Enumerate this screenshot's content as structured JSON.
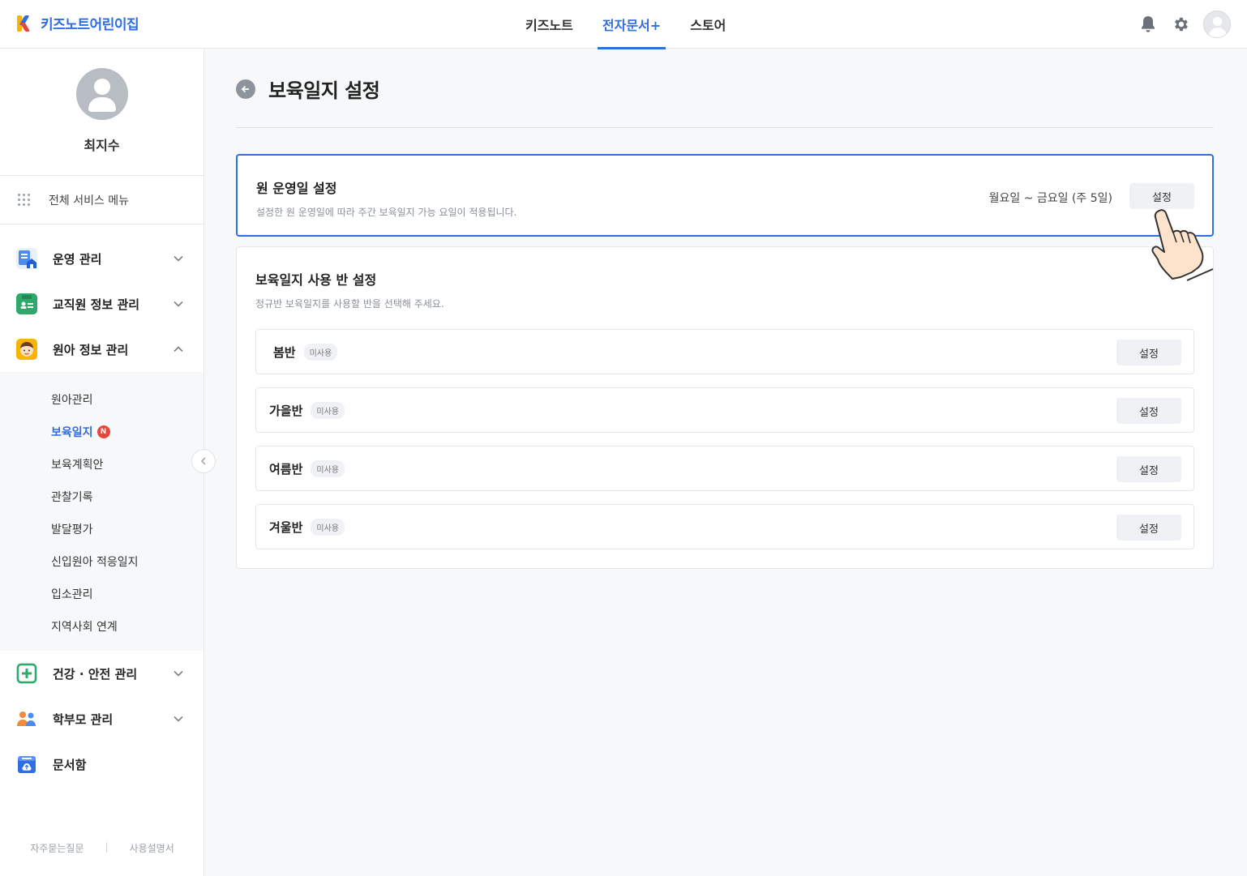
{
  "brand": {
    "name": "키즈노트어린이집"
  },
  "topnav": {
    "items": [
      {
        "label": "키즈노트"
      },
      {
        "label": "전자문서+"
      },
      {
        "label": "스토어"
      }
    ]
  },
  "profile": {
    "name": "최지수"
  },
  "sidebar": {
    "all_menu_label": "전체 서비스 메뉴",
    "menu": [
      {
        "label": "운영 관리",
        "icon": "building-icon"
      },
      {
        "label": "교직원 정보 관리",
        "icon": "id-card-icon"
      },
      {
        "label": "원아 정보 관리",
        "icon": "child-face-icon"
      },
      {
        "label": "건강 · 안전 관리",
        "icon": "medical-icon"
      },
      {
        "label": "학부모 관리",
        "icon": "parents-icon"
      },
      {
        "label": "문서함",
        "icon": "folder-icon"
      }
    ],
    "submenu": [
      {
        "label": "원아관리"
      },
      {
        "label": "보육일지",
        "badge": "N"
      },
      {
        "label": "보육계획안"
      },
      {
        "label": "관찰기록"
      },
      {
        "label": "발달평가"
      },
      {
        "label": "신입원아 적응일지"
      },
      {
        "label": "입소관리"
      },
      {
        "label": "지역사회 연계"
      }
    ],
    "footer": {
      "faq": "자주묻는질문",
      "separator": "|",
      "manual": "사용설명서"
    }
  },
  "page": {
    "title": "보육일지 설정"
  },
  "operating_days": {
    "title": "원 운영일 설정",
    "description": "설정한 원 운영일에 따라 주간 보육일지 가능 요일이 적용됩니다.",
    "value": "월요일 ~ 금요일 (주 5일)",
    "button": "설정"
  },
  "class_settings": {
    "title": "보육일지 사용 반 설정",
    "description": "정규반 보육일지를 사용할 반을 선택해 주세요.",
    "classes": [
      {
        "name": "봄반",
        "status": "미사용",
        "button": "설정"
      },
      {
        "name": "가을반",
        "status": "미사용",
        "button": "설정"
      },
      {
        "name": "여름반",
        "status": "미사용",
        "button": "설정"
      },
      {
        "name": "겨울반",
        "status": "미사용",
        "button": "설정"
      }
    ]
  },
  "colors": {
    "accent": "#2f6de1",
    "badge": "#e8453c"
  }
}
